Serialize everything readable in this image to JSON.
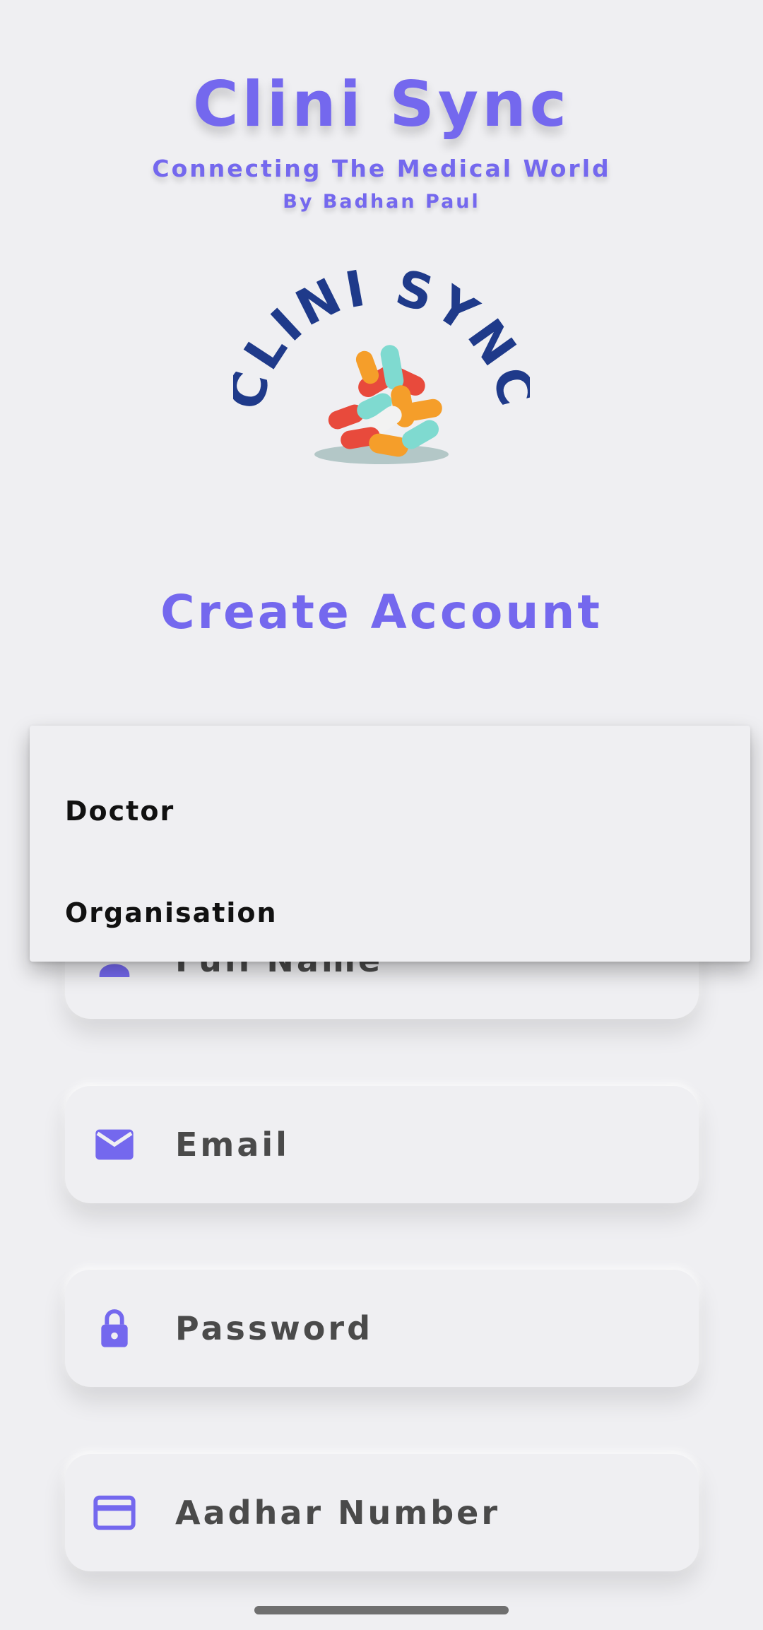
{
  "header": {
    "app_title": "Clini Sync",
    "tagline": "Connecting The Medical World",
    "author": "By Badhan Paul"
  },
  "logo": {
    "text": "CLINI SYNC",
    "icon": "pills-icon"
  },
  "form": {
    "title": "Create Account",
    "fields": [
      {
        "label": "Full Name",
        "icon": "person-icon"
      },
      {
        "label": "Email",
        "icon": "email-icon"
      },
      {
        "label": "Password",
        "icon": "lock-icon"
      },
      {
        "label": "Aadhar Number",
        "icon": "card-icon"
      }
    ]
  },
  "role_dropdown": {
    "options": [
      "Doctor",
      "Organisation"
    ]
  },
  "colors": {
    "accent": "#7468ee",
    "background": "#efeff2",
    "logo_text": "#1f3a8a"
  }
}
